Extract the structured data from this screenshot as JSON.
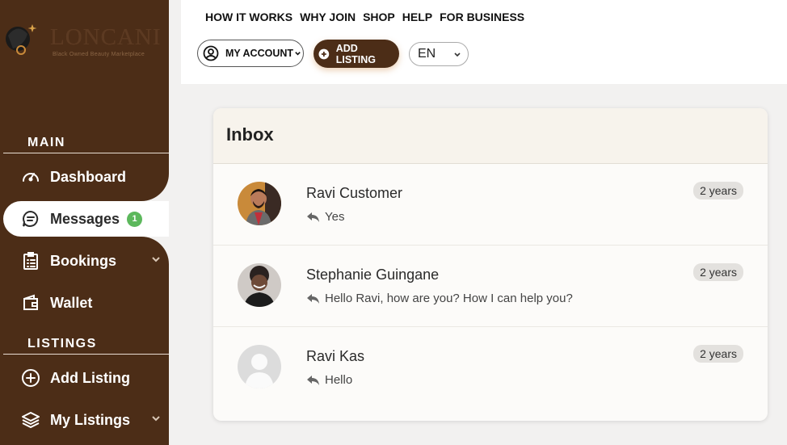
{
  "brand": {
    "name": "LONCANI",
    "tagline": "Black Owned Beauty Marketplace"
  },
  "sidebar": {
    "sections": [
      {
        "title": "MAIN"
      },
      {
        "title": "LISTINGS"
      }
    ],
    "items": [
      {
        "label": "Dashboard",
        "icon": "dashboard-icon"
      },
      {
        "label": "Messages",
        "icon": "messages-icon",
        "badge": "1",
        "active": true
      },
      {
        "label": "Bookings",
        "icon": "bookings-icon",
        "dropdown": true
      },
      {
        "label": "Wallet",
        "icon": "wallet-icon"
      },
      {
        "label": "Add Listing",
        "icon": "plus-circle-icon"
      },
      {
        "label": "My Listings",
        "icon": "layers-icon",
        "dropdown": true
      }
    ]
  },
  "topnav": {
    "links": [
      "HOW IT WORKS",
      "WHY JOIN",
      "SHOP",
      "HELP",
      "FOR BUSINESS"
    ],
    "account_label": "MY ACCOUNT",
    "add_listing_label": "ADD LISTING",
    "language": "EN"
  },
  "inbox": {
    "title": "Inbox",
    "messages": [
      {
        "name": "Ravi Customer",
        "preview": "Yes",
        "time": "2 years"
      },
      {
        "name": "Stephanie Guingane",
        "preview": "Hello Ravi, how are you? How I can help you?",
        "time": "2 years"
      },
      {
        "name": "Ravi Kas",
        "preview": "Hello",
        "time": "2 years"
      }
    ]
  },
  "colors": {
    "sidebar": "#4c2d17",
    "badge": "#5cb85c",
    "accent_glow": "#d2965a"
  }
}
